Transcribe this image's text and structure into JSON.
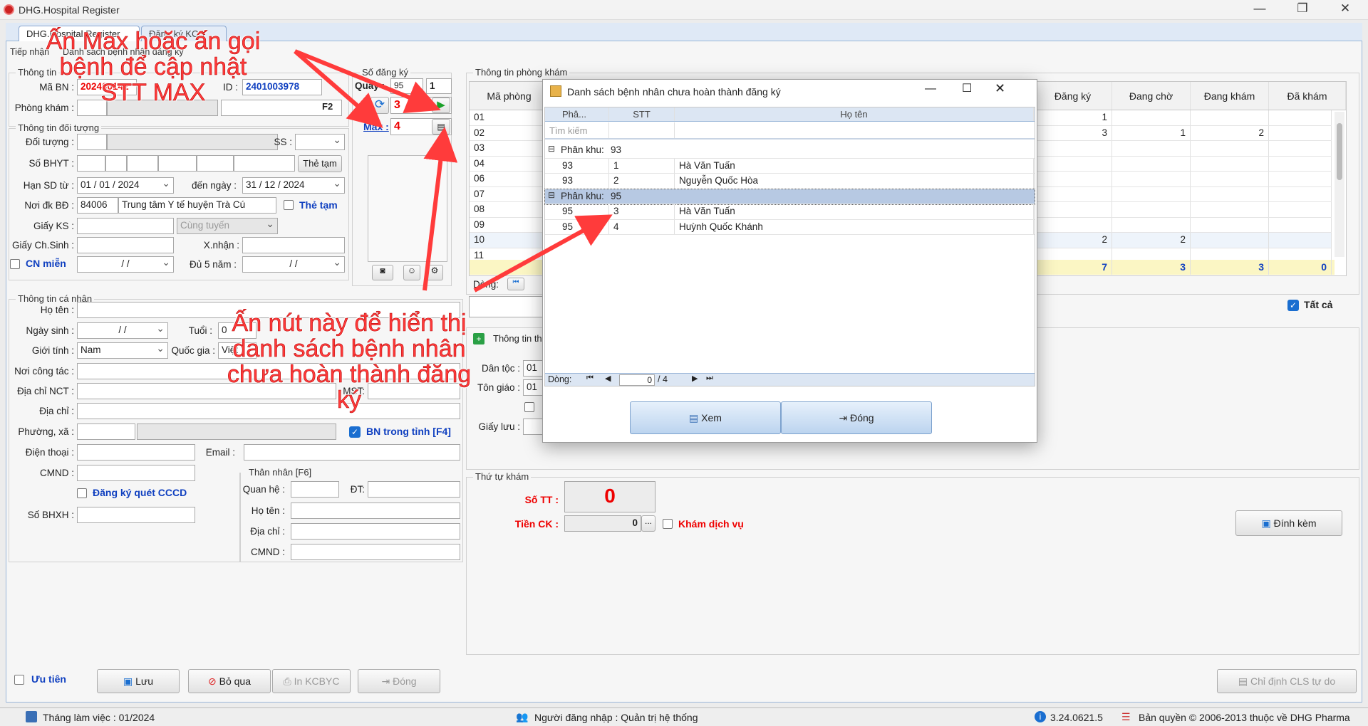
{
  "window": {
    "title": "DHG.Hospital Register",
    "min": "—",
    "max": "❐",
    "close": "✕"
  },
  "tabs": [
    "DHG.Hospital Register",
    "Đăng ký KCB"
  ],
  "subtabs": [
    "Tiếp nhận",
    "Danh sách bệnh nhân đăng ký"
  ],
  "patient": {
    "group_title": "Thông tin",
    "ma_bn_label": "Mã BN :",
    "ma_bn": "202400142",
    "id_label": "ID :",
    "id": "2401003978",
    "phong_kham_label": "Phòng khám :",
    "f2": "F2",
    "so_dang_ky_title": "Số đăng ký",
    "quay_label": "Quầy :",
    "quay_value": "95",
    "quay_n": "1",
    "stt_value": "3",
    "max_label": "Max :",
    "max_value": "4"
  },
  "doituong": {
    "title": "Thông tin đối tượng",
    "doi_tuong_label": "Đối tượng :",
    "ss_label": "SS :",
    "so_bhyt_label": "Số BHYT :",
    "the_tam_btn": "Thẻ tạm",
    "han_sd_label": "Hạn SD từ :",
    "han_tu": "01 / 01 / 2024",
    "den_ngay_label": "đến ngày :",
    "han_den": "31 / 12 / 2024",
    "noi_dk_label": "Nơi đk BĐ :",
    "noi_dk_code": "84006",
    "noi_dk_name": "Trung tâm Y tế huyện Trà Cú",
    "the_tam_chk": "Thẻ tạm",
    "giay_ks_label": "Giấy KS :",
    "cung_tuyen": "Cùng tuyến",
    "giay_cs_label": "Giấy Ch.Sinh :",
    "xnhan_label": "X.nhận :",
    "cn_mien": "CN miễn",
    "date_blank": "/     /",
    "du5_label": "Đủ 5 năm :"
  },
  "canhan": {
    "title": "Thông tin cá nhân",
    "ho_ten_label": "Họ tên :",
    "ngay_sinh_label": "Ngày sinh :",
    "tuoi_label": "Tuổi :",
    "tuoi": "0",
    "gioi_tinh_label": "Giới tính :",
    "gioi_tinh": "Nam",
    "quoc_gia_label": "Quốc gia :",
    "quoc_gia": "Việt",
    "noi_ct_label": "Nơi công tác :",
    "dia_chi_nct_label": "Địa chỉ  NCT :",
    "mst_label": "MST:",
    "dia_chi_label": "Địa chỉ :",
    "phuong_xa_label": "Phường, xã :",
    "bn_trong_tinh": "BN trong tỉnh [F4]",
    "dien_thoai_label": "Điện thoại :",
    "email_label": "Email :",
    "cmnd_label": "CMND :",
    "dk_cccd": "Đăng ký quét CCCD",
    "so_bhxh_label": "Số BHXH :",
    "than_nhan_title": "Thân nhân [F6]",
    "quan_he_label": "Quan hệ :",
    "dt_label": "ĐT:",
    "tn_ho_ten_label": "Họ tên :",
    "tn_dia_chi_label": "Địa chỉ :",
    "tn_cmnd_label": "CMND :"
  },
  "phongkham": {
    "title": "Thông tin phòng khám",
    "headers": [
      "Mã phòng",
      "Đăng ký",
      "Đang chờ",
      "Đang khám",
      "Đã khám"
    ],
    "rows": [
      [
        "01",
        "1",
        "",
        "",
        ""
      ],
      [
        "02",
        "3",
        "1",
        "2",
        ""
      ],
      [
        "03",
        "",
        "",
        "",
        ""
      ],
      [
        "04",
        "",
        "",
        "",
        ""
      ],
      [
        "06",
        "",
        "",
        "",
        ""
      ],
      [
        "07",
        "",
        "",
        "",
        ""
      ],
      [
        "08",
        "",
        "",
        "",
        ""
      ],
      [
        "09",
        "",
        "",
        "",
        ""
      ],
      [
        "10",
        "2",
        "2",
        "",
        ""
      ],
      [
        "11",
        "",
        "",
        "",
        ""
      ]
    ],
    "totals": [
      "7",
      "3",
      "3",
      "0"
    ],
    "dong_label": "Dòng:",
    "tat_ca": "Tất cả"
  },
  "right_lower": {
    "thong_tin_label": "Thông tin th",
    "dan_toc_label": "Dân tộc :",
    "dan_toc": "01",
    "ton_giao_label": "Tôn giáo :",
    "ton_giao": "01",
    "giay_luu_label": "Giấy lưu :"
  },
  "thutu": {
    "title": "Thứ tự khám",
    "so_tt_label": "Số TT :",
    "so_tt": "0",
    "tien_ck_label": "Tiền CK :",
    "tien_ck": "0",
    "ellipsis": "...",
    "kham_dich_vu": "Khám dịch vụ",
    "dinh_kem": "Đính kèm"
  },
  "bottom": {
    "uu_tien": "Ưu tiên",
    "luu": "Lưu",
    "bo_qua": "Bỏ qua",
    "in_kcbyc": "In KCBYC",
    "dong": "Đóng",
    "chi_dinh": "Chỉ định CLS tự do"
  },
  "status": {
    "thang": "Tháng làm việc : 01/2024",
    "nguoi": "Người đăng nhập : Quản trị hệ thống",
    "version": "3.24.0621.5",
    "copyright": "Bản quyền © 2006-2013 thuộc về DHG Pharma"
  },
  "dialog": {
    "title": "Danh sách bệnh nhân chưa hoàn thành đăng ký",
    "headers": [
      "Phâ...",
      "STT",
      "Họ tên"
    ],
    "search_placeholder": "Tìm kiếm",
    "group_label": "Phân khu:",
    "groups": [
      {
        "name": "93",
        "rows": [
          [
            "93",
            "1",
            "Hà Văn Tuấn"
          ],
          [
            "93",
            "2",
            "Nguyễn Quốc Hòa"
          ]
        ]
      },
      {
        "name": "95",
        "rows": [
          [
            "95",
            "3",
            "Hà Văn Tuấn"
          ],
          [
            "95",
            "4",
            "Huỳnh Quốc Khánh"
          ]
        ]
      }
    ],
    "nav_label": "Dòng:",
    "nav_index": "0",
    "nav_total": "/   4",
    "xem": "Xem",
    "dong": "Đóng"
  },
  "annotations": {
    "a1": "Ấn Max hoặc ấn gọi bệnh để cập nhật STT MAX",
    "a2": "Ấn nút này để hiển thị danh sách bệnh nhân chưa hoàn thành đăng ký"
  }
}
